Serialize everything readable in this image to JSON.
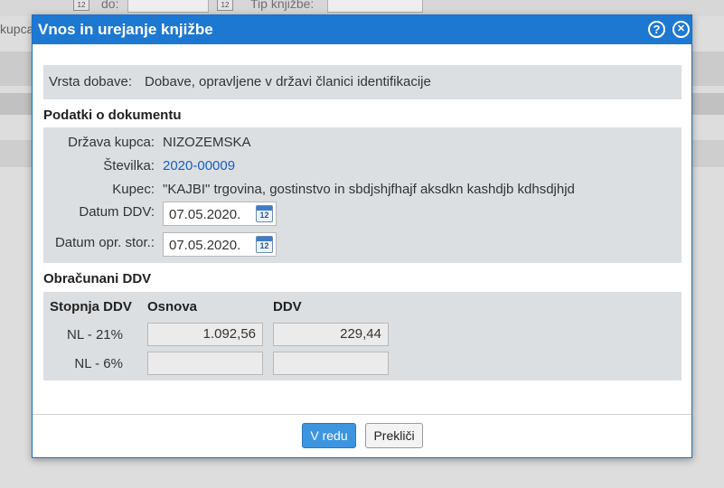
{
  "background": {
    "label_do": "do:",
    "label_tip": "Tip knjižbe:",
    "label_kupca": "kupca",
    "cal_num": "12"
  },
  "dialog": {
    "title": "Vnos in urejanje knjižbe",
    "help_glyph": "?",
    "close_glyph": "✕",
    "vrsta_label": "Vrsta dobave:",
    "vrsta_value": "Dobave, opravljene v državi članici identifikacije",
    "section_document": "Podatki o dokumentu",
    "fields": {
      "drzava_label": "Država kupca:",
      "drzava_value": "NIZOZEMSKA",
      "stevilka_label": "Številka:",
      "stevilka_value": "2020-00009",
      "kupec_label": "Kupec:",
      "kupec_value": "\"KAJBI\" trgovina, gostinstvo in sbdjshjfhajf aksdkn kashdjb kdhsdjhjd",
      "datum_ddv_label": "Datum DDV:",
      "datum_ddv_value": "07.05.2020.",
      "datum_opr_label": "Datum opr. stor.:",
      "datum_opr_value": "07.05.2020.",
      "cal_num": "12"
    },
    "section_vat": "Obračunani DDV",
    "vat_table": {
      "headers": [
        "Stopnja DDV",
        "Osnova",
        "DDV"
      ],
      "rows": [
        {
          "rate": "NL - 21%",
          "osnova": "1.092,56",
          "ddv": "229,44"
        },
        {
          "rate": "NL - 6%",
          "osnova": "",
          "ddv": ""
        }
      ]
    },
    "buttons": {
      "ok": "V redu",
      "cancel": "Prekliči"
    }
  }
}
